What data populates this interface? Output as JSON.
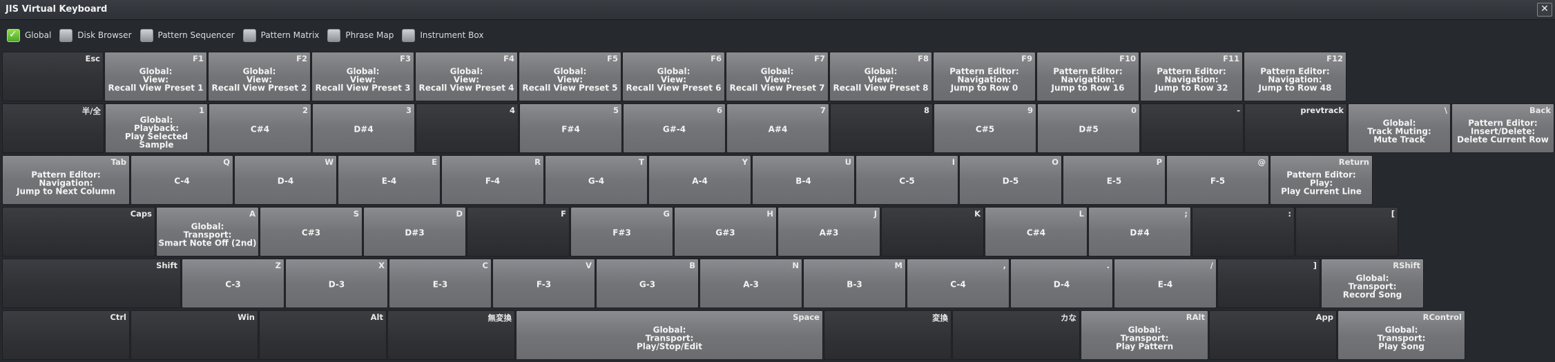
{
  "window": {
    "title": "JIS Virtual Keyboard",
    "close_glyph": "✕"
  },
  "filters": [
    {
      "label": "Global",
      "checked": true
    },
    {
      "label": "Disk Browser",
      "checked": false
    },
    {
      "label": "Pattern Sequencer",
      "checked": false
    },
    {
      "label": "Pattern Matrix",
      "checked": false
    },
    {
      "label": "Phrase Map",
      "checked": false
    },
    {
      "label": "Instrument Box",
      "checked": false
    }
  ],
  "rows": [
    [
      {
        "key": "Esc",
        "action": "",
        "style": "dark"
      },
      {
        "key": "F1",
        "action": "Global:\nView:\nRecall View Preset 1",
        "style": "light"
      },
      {
        "key": "F2",
        "action": "Global:\nView:\nRecall View Preset 2",
        "style": "light"
      },
      {
        "key": "F3",
        "action": "Global:\nView:\nRecall View Preset 3",
        "style": "light"
      },
      {
        "key": "F4",
        "action": "Global:\nView:\nRecall View Preset 4",
        "style": "light"
      },
      {
        "key": "F5",
        "action": "Global:\nView:\nRecall View Preset 5",
        "style": "light"
      },
      {
        "key": "F6",
        "action": "Global:\nView:\nRecall View Preset 6",
        "style": "light"
      },
      {
        "key": "F7",
        "action": "Global:\nView:\nRecall View Preset 7",
        "style": "light"
      },
      {
        "key": "F8",
        "action": "Global:\nView:\nRecall View Preset 8",
        "style": "light"
      },
      {
        "key": "F9",
        "action": "Pattern Editor:\nNavigation:\nJump to Row 0",
        "style": "light"
      },
      {
        "key": "F10",
        "action": "Pattern Editor:\nNavigation:\nJump to Row 16",
        "style": "light"
      },
      {
        "key": "F11",
        "action": "Pattern Editor:\nNavigation:\nJump to Row 32",
        "style": "light"
      },
      {
        "key": "F12",
        "action": "Pattern Editor:\nNavigation:\nJump to Row 48",
        "style": "light"
      }
    ],
    [
      {
        "key": "半/全",
        "action": "",
        "style": "dark"
      },
      {
        "key": "1",
        "action": "Global:\nPlayback:\nPlay Selected Sample",
        "style": "light"
      },
      {
        "key": "2",
        "action": "C#4",
        "style": "light"
      },
      {
        "key": "3",
        "action": "D#4",
        "style": "light"
      },
      {
        "key": "4",
        "action": "",
        "style": "dark"
      },
      {
        "key": "5",
        "action": "F#4",
        "style": "light"
      },
      {
        "key": "6",
        "action": "G#-4",
        "style": "light"
      },
      {
        "key": "7",
        "action": "A#4",
        "style": "light"
      },
      {
        "key": "8",
        "action": "",
        "style": "dark"
      },
      {
        "key": "9",
        "action": "C#5",
        "style": "light"
      },
      {
        "key": "0",
        "action": "D#5",
        "style": "light"
      },
      {
        "key": "-",
        "action": "",
        "style": "dark"
      },
      {
        "key": "prevtrack",
        "action": "",
        "style": "dark"
      },
      {
        "key": "\\",
        "action": "Global:\nTrack Muting:\nMute Track",
        "style": "light"
      },
      {
        "key": "Back",
        "action": "Pattern Editor:\nInsert/Delete:\nDelete Current Row",
        "style": "light"
      }
    ],
    [
      {
        "key": "Tab",
        "action": "Pattern Editor:\nNavigation:\nJump to Next Column",
        "style": "light"
      },
      {
        "key": "Q",
        "action": "C-4",
        "style": "light"
      },
      {
        "key": "W",
        "action": "D-4",
        "style": "light"
      },
      {
        "key": "E",
        "action": "E-4",
        "style": "light"
      },
      {
        "key": "R",
        "action": "F-4",
        "style": "light"
      },
      {
        "key": "T",
        "action": "G-4",
        "style": "light"
      },
      {
        "key": "Y",
        "action": "A-4",
        "style": "light"
      },
      {
        "key": "U",
        "action": "B-4",
        "style": "light"
      },
      {
        "key": "I",
        "action": "C-5",
        "style": "light"
      },
      {
        "key": "O",
        "action": "D-5",
        "style": "light"
      },
      {
        "key": "P",
        "action": "E-5",
        "style": "light"
      },
      {
        "key": "@",
        "action": "F-5",
        "style": "light"
      },
      {
        "key": "Return",
        "action": "Pattern Editor:\nPlay:\nPlay Current Line",
        "style": "light"
      }
    ],
    [
      {
        "key": "Caps",
        "action": "",
        "style": "dark"
      },
      {
        "key": "A",
        "action": "Global:\nTransport:\nSmart Note Off (2nd)",
        "style": "light"
      },
      {
        "key": "S",
        "action": "C#3",
        "style": "light"
      },
      {
        "key": "D",
        "action": "D#3",
        "style": "light"
      },
      {
        "key": "F",
        "action": "",
        "style": "dark"
      },
      {
        "key": "G",
        "action": "F#3",
        "style": "light"
      },
      {
        "key": "H",
        "action": "G#3",
        "style": "light"
      },
      {
        "key": "J",
        "action": "A#3",
        "style": "light"
      },
      {
        "key": "K",
        "action": "",
        "style": "dark"
      },
      {
        "key": "L",
        "action": "C#4",
        "style": "light"
      },
      {
        "key": ";",
        "action": "D#4",
        "style": "light"
      },
      {
        "key": ":",
        "action": "",
        "style": "dark"
      },
      {
        "key": "[",
        "action": "",
        "style": "dark"
      }
    ],
    [
      {
        "key": "Shift",
        "action": "",
        "style": "dark"
      },
      {
        "key": "Z",
        "action": "C-3",
        "style": "light"
      },
      {
        "key": "X",
        "action": "D-3",
        "style": "light"
      },
      {
        "key": "C",
        "action": "E-3",
        "style": "light"
      },
      {
        "key": "V",
        "action": "F-3",
        "style": "light"
      },
      {
        "key": "B",
        "action": "G-3",
        "style": "light"
      },
      {
        "key": "N",
        "action": "A-3",
        "style": "light"
      },
      {
        "key": "M",
        "action": "B-3",
        "style": "light"
      },
      {
        "key": ",",
        "action": "C-4",
        "style": "light"
      },
      {
        "key": ".",
        "action": "D-4",
        "style": "light"
      },
      {
        "key": "/",
        "action": "E-4",
        "style": "light"
      },
      {
        "key": "]",
        "action": "",
        "style": "dark"
      },
      {
        "key": "RShift",
        "action": "Global:\nTransport:\nRecord Song",
        "style": "light"
      }
    ],
    [
      {
        "key": "Ctrl",
        "action": "",
        "style": "dark"
      },
      {
        "key": "Win",
        "action": "",
        "style": "dark"
      },
      {
        "key": "Alt",
        "action": "",
        "style": "dark"
      },
      {
        "key": "無変換",
        "action": "",
        "style": "dark"
      },
      {
        "key": "Space",
        "action": "Global:\nTransport:\nPlay/Stop/Edit",
        "style": "light"
      },
      {
        "key": "変換",
        "action": "",
        "style": "dark"
      },
      {
        "key": "カな",
        "action": "",
        "style": "dark"
      },
      {
        "key": "RAlt",
        "action": "Global:\nTransport:\nPlay Pattern",
        "style": "light"
      },
      {
        "key": "App",
        "action": "",
        "style": "dark"
      },
      {
        "key": "RControl",
        "action": "Global:\nTransport:\nPlay Song",
        "style": "light"
      }
    ]
  ]
}
